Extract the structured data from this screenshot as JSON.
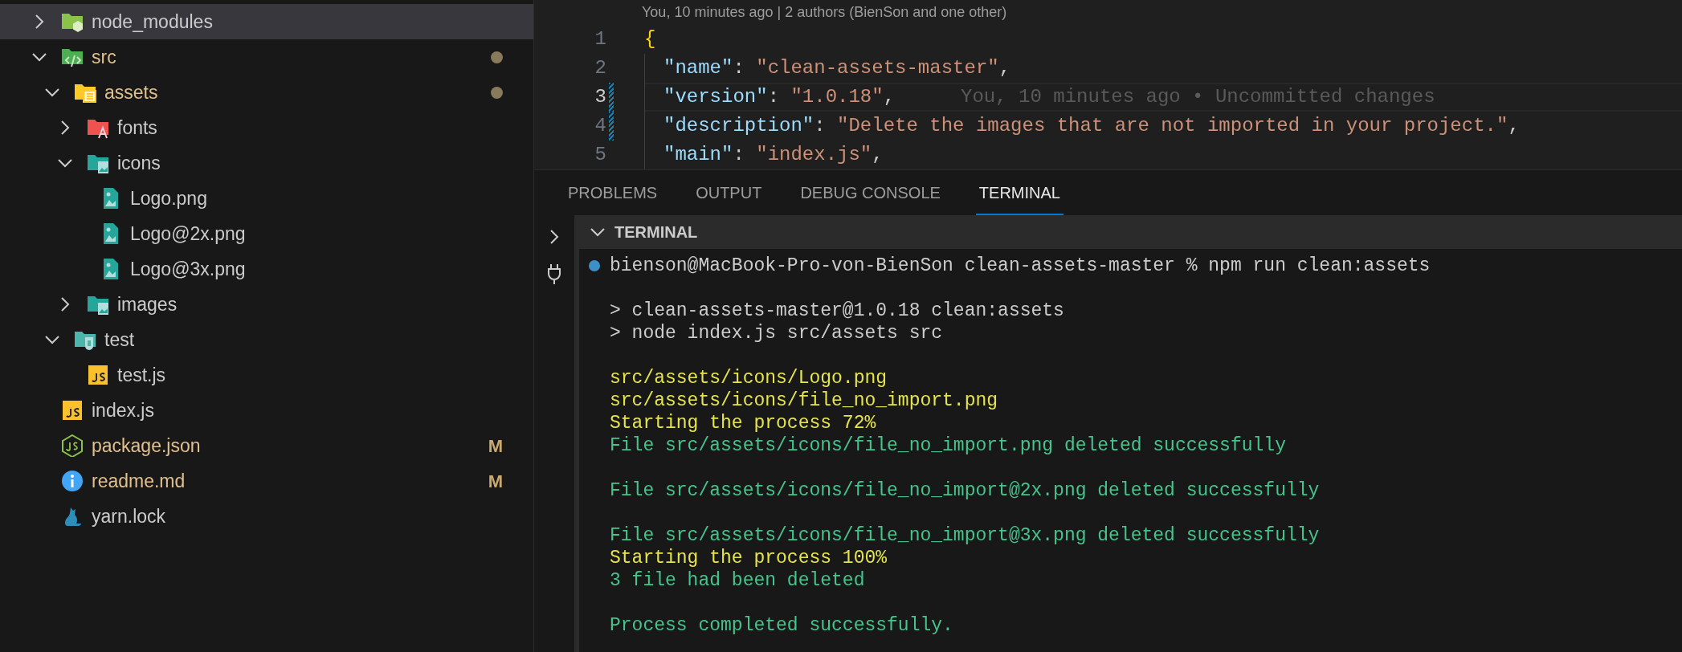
{
  "explorer": {
    "items": [
      {
        "name": "node_modules",
        "kind": "nodefolder",
        "expanded": false,
        "selected": true,
        "modified": false
      },
      {
        "name": "src",
        "kind": "srcfolder",
        "expanded": true,
        "selected": false,
        "modified": true,
        "children": [
          {
            "name": "assets",
            "kind": "assetsfolder",
            "expanded": true,
            "selected": false,
            "modified": true,
            "children": [
              {
                "name": "fonts",
                "kind": "fontsfolder",
                "expanded": false,
                "selected": false,
                "modified": false
              },
              {
                "name": "icons",
                "kind": "imagefolder",
                "expanded": true,
                "selected": false,
                "modified": false,
                "children": [
                  {
                    "name": "Logo.png",
                    "kind": "image",
                    "selected": false,
                    "modified": false
                  },
                  {
                    "name": "Logo@2x.png",
                    "kind": "image",
                    "selected": false,
                    "modified": false
                  },
                  {
                    "name": "Logo@3x.png",
                    "kind": "image",
                    "selected": false,
                    "modified": false
                  }
                ]
              },
              {
                "name": "images",
                "kind": "imagefolder",
                "expanded": false,
                "selected": false,
                "modified": false
              }
            ]
          },
          {
            "name": "test",
            "kind": "testfolder",
            "expanded": true,
            "selected": false,
            "modified": false,
            "children": [
              {
                "name": "test.js",
                "kind": "js",
                "selected": false,
                "modified": false
              }
            ]
          }
        ]
      },
      {
        "name": "index.js",
        "kind": "js",
        "selected": false,
        "modified": false
      },
      {
        "name": "package.json",
        "kind": "nodejs",
        "selected": false,
        "modified": true,
        "badge": "M"
      },
      {
        "name": "readme.md",
        "kind": "info",
        "selected": false,
        "modified": true,
        "badge": "M"
      },
      {
        "name": "yarn.lock",
        "kind": "yarn",
        "selected": false,
        "modified": false
      }
    ]
  },
  "editor": {
    "blame_header": "You, 10 minutes ago | 2 authors (BienSon and one other)",
    "lines": [
      {
        "number": "1",
        "current": false,
        "changed": false,
        "tokens": [
          {
            "kind": "brace",
            "text": "{"
          }
        ]
      },
      {
        "number": "2",
        "current": false,
        "changed": false,
        "tokens": [
          {
            "kind": "key",
            "text": "\"name\""
          },
          {
            "kind": "punct",
            "text": ": "
          },
          {
            "kind": "string",
            "text": "\"clean-assets-master\""
          },
          {
            "kind": "punct",
            "text": ","
          }
        ]
      },
      {
        "number": "3",
        "current": true,
        "changed": true,
        "blame": "You, 10 minutes ago • Uncommitted changes",
        "tokens": [
          {
            "kind": "key",
            "text": "\"version\""
          },
          {
            "kind": "punct",
            "text": ": "
          },
          {
            "kind": "string",
            "text": "\"1.0.18\""
          },
          {
            "kind": "punct",
            "text": ","
          }
        ]
      },
      {
        "number": "4",
        "current": false,
        "changed": true,
        "tokens": [
          {
            "kind": "key",
            "text": "\"description\""
          },
          {
            "kind": "punct",
            "text": ": "
          },
          {
            "kind": "string",
            "text": "\"Delete the images that are not imported in your project.\""
          },
          {
            "kind": "punct",
            "text": ","
          }
        ]
      },
      {
        "number": "5",
        "current": false,
        "changed": false,
        "tokens": [
          {
            "kind": "key",
            "text": "\"main\""
          },
          {
            "kind": "punct",
            "text": ": "
          },
          {
            "kind": "string",
            "text": "\"index.js\""
          },
          {
            "kind": "punct",
            "text": ","
          }
        ]
      }
    ]
  },
  "panel": {
    "tabs": [
      {
        "label": "PROBLEMS",
        "selected": false
      },
      {
        "label": "OUTPUT",
        "selected": false
      },
      {
        "label": "DEBUG CONSOLE",
        "selected": false
      },
      {
        "label": "TERMINAL",
        "selected": true
      }
    ],
    "section": {
      "title": "TERMINAL",
      "expanded": true
    },
    "terminal_lines": [
      {
        "kind": "prompt",
        "text": "bienson@MacBook-Pro-von-BienSon clean-assets-master % npm run clean:assets"
      },
      {
        "kind": "blank"
      },
      {
        "kind": "plain",
        "text": "> clean-assets-master@1.0.18 clean:assets"
      },
      {
        "kind": "plain",
        "text": "> node index.js src/assets src"
      },
      {
        "kind": "blank"
      },
      {
        "kind": "warning",
        "text": "src/assets/icons/Logo.png"
      },
      {
        "kind": "warning",
        "text": "src/assets/icons/file_no_import.png"
      },
      {
        "kind": "warning",
        "text": "Starting the process 72%"
      },
      {
        "kind": "success",
        "text": "File src/assets/icons/file_no_import.png deleted successfully"
      },
      {
        "kind": "blank"
      },
      {
        "kind": "success",
        "text": "File src/assets/icons/file_no_import@2x.png deleted successfully"
      },
      {
        "kind": "blank"
      },
      {
        "kind": "success",
        "text": "File src/assets/icons/file_no_import@3x.png deleted successfully"
      },
      {
        "kind": "warning",
        "text": "Starting the process 100%"
      },
      {
        "kind": "success",
        "text": "3 file had been deleted"
      },
      {
        "kind": "blank"
      },
      {
        "kind": "success",
        "text": "Process completed successfully."
      }
    ]
  }
}
